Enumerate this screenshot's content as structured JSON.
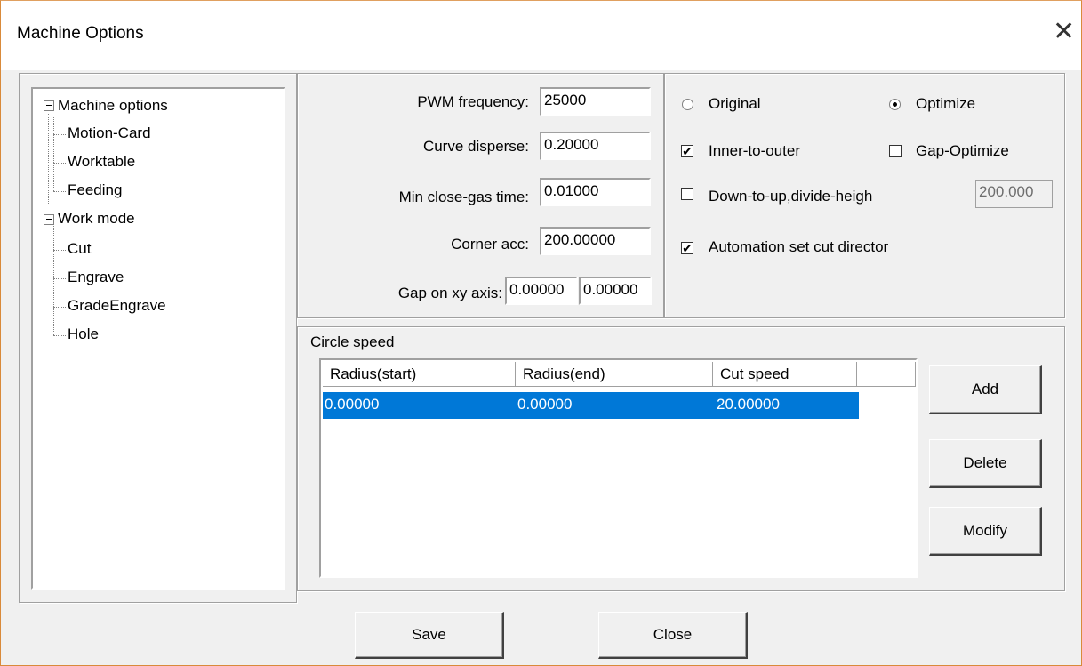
{
  "window": {
    "title": "Machine Options"
  },
  "tree": {
    "root1": "Machine options",
    "root1_children": [
      "Motion-Card",
      "Worktable",
      "Feeding"
    ],
    "root2": "Work mode",
    "root2_children": [
      "Cut",
      "Engrave",
      "GradeEngrave",
      "Hole"
    ]
  },
  "params": {
    "pwm_label": "PWM frequency:",
    "pwm_value": "25000",
    "curve_label": "Curve disperse:",
    "curve_value": "0.20000",
    "gas_label": "Min close-gas time:",
    "gas_value": "0.01000",
    "corner_label": "Corner acc:",
    "corner_value": "200.00000",
    "gap_label": "Gap on xy axis:",
    "gap_x_value": "0.00000",
    "gap_y_value": "0.00000"
  },
  "options": {
    "original_label": "Original",
    "original_selected": false,
    "optimize_label": "Optimize",
    "optimize_selected": true,
    "inner_label": "Inner-to-outer",
    "inner_checked": true,
    "gap_opt_label": "Gap-Optimize",
    "gap_opt_checked": false,
    "down_label": "Down-to-up,divide-heigh",
    "down_checked": false,
    "divide_height_value": "200.000",
    "auto_label": "Automation set cut director",
    "auto_checked": true
  },
  "circle_speed": {
    "legend": "Circle speed",
    "columns": [
      "Radius(start)",
      "Radius(end)",
      "Cut speed"
    ],
    "rows": [
      [
        "0.00000",
        "0.00000",
        "20.00000"
      ]
    ],
    "add_label": "Add",
    "delete_label": "Delete",
    "modify_label": "Modify"
  },
  "footer": {
    "save_label": "Save",
    "close_label": "Close"
  }
}
